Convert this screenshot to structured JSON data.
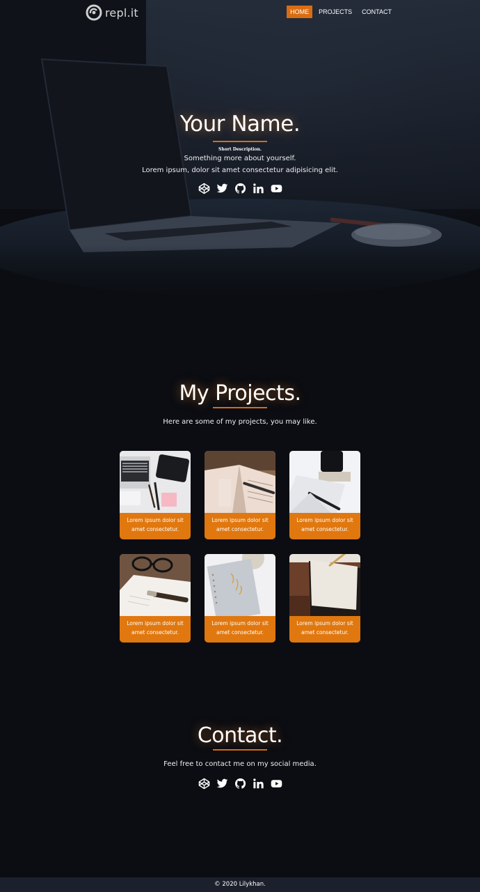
{
  "nav": {
    "logo_text": "repl.it",
    "links": [
      "HOME",
      "PROJECTS",
      "CONTACT"
    ]
  },
  "hero": {
    "title": "Your Name.",
    "short_description": "Short Description.",
    "line1": "Something more about yourself.",
    "line2": "Lorem ipsum, dolor sit amet consectetur adipisicing elit."
  },
  "socials": [
    "codepen-icon",
    "twitter-icon",
    "github-icon",
    "linkedin-icon",
    "youtube-icon"
  ],
  "projects": {
    "title": "My Projects.",
    "subtitle": "Here are some of my projects, you may like.",
    "cards": [
      {
        "text": "Lorem ipsum dolor sit amet consectetur."
      },
      {
        "text": "Lorem ipsum dolor sit amet consectetur."
      },
      {
        "text": "Lorem ipsum dolor sit amet consectetur."
      },
      {
        "text": "Lorem ipsum dolor sit amet consectetur."
      },
      {
        "text": "Lorem ipsum dolor sit amet consectetur."
      },
      {
        "text": "Lorem ipsum dolor sit amet consectetur."
      }
    ]
  },
  "contact": {
    "title": "Contact.",
    "subtitle": "Feel free to contact me on my social media."
  },
  "footer": {
    "text": "© 2020 Lilykhan."
  },
  "colors": {
    "accent": "#d96d12",
    "background": "#0b0d12",
    "footer": "#1b202c"
  }
}
